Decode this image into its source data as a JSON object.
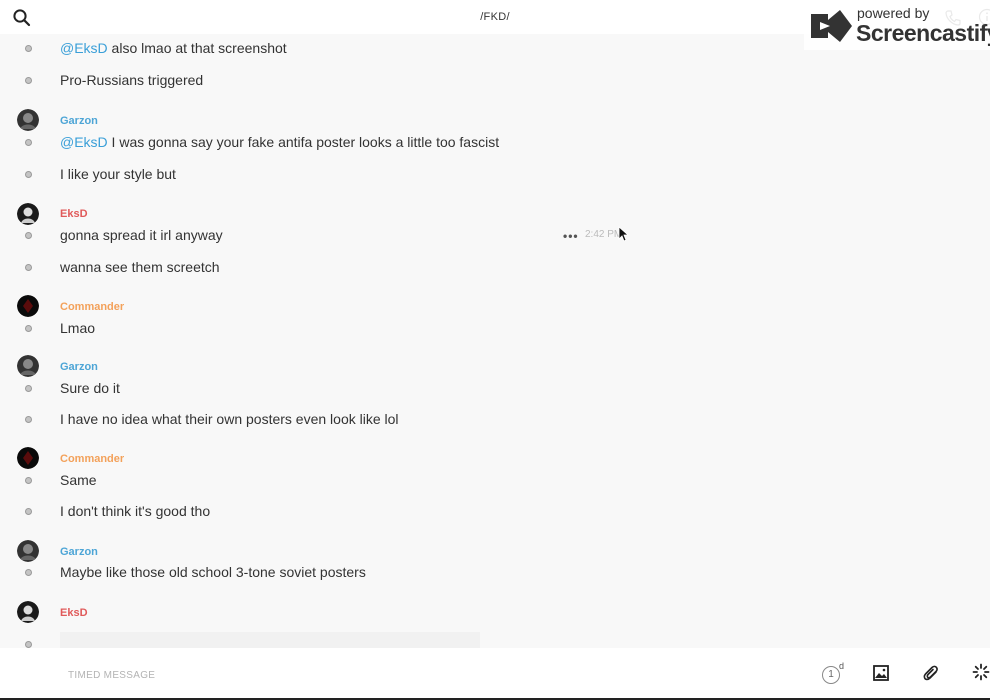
{
  "header": {
    "channel_title": "/FKD/"
  },
  "watermark": {
    "small": "powered by",
    "big": "Screencastify"
  },
  "messages": [
    {
      "mention": "@EksD",
      "text": " also lmao at that screenshot"
    },
    {
      "text": "Pro-Russians triggered"
    },
    {
      "author": "Garzon"
    },
    {
      "mention": "@EksD",
      "text": " I was gonna say your fake antifa poster looks a little too fascist"
    },
    {
      "text": "I like your style but"
    },
    {
      "author": "EksD"
    },
    {
      "text": "gonna spread it irl anyway"
    },
    {
      "text": "wanna see them screetch"
    },
    {
      "author": "Commander"
    },
    {
      "text": "Lmao"
    },
    {
      "author": "Garzon"
    },
    {
      "text": "Sure do it"
    },
    {
      "text": "I have no idea what their own posters even look like lol"
    },
    {
      "author": "Commander"
    },
    {
      "text": "Same"
    },
    {
      "text": "I don't think it's good tho"
    },
    {
      "author": "Garzon"
    },
    {
      "text": "Maybe like those old school 3-tone soviet posters"
    },
    {
      "author": "EksD"
    }
  ],
  "hover": {
    "more_label": "•••",
    "timestamp": "2:42 PM"
  },
  "composer": {
    "placeholder": "TIMED MESSAGE",
    "timer_value": "1",
    "timer_unit": "d"
  },
  "colors": {
    "mention": "#3a9fd8",
    "garzon": "#4da5d6",
    "eksd": "#e05a5a",
    "commander": "#f3a15a"
  }
}
